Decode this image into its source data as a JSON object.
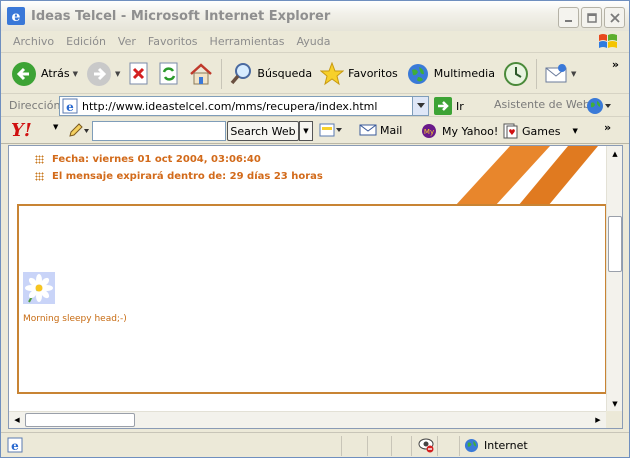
{
  "window": {
    "title": "Ideas Telcel - Microsoft Internet Explorer"
  },
  "menu": [
    "Archivo",
    "Edición",
    "Ver",
    "Favoritos",
    "Herramientas",
    "Ayuda"
  ],
  "toolbar": {
    "back_label": "Atrás",
    "search_label": "Búsqueda",
    "favorites_label": "Favoritos",
    "media_label": "Multimedia"
  },
  "address": {
    "label": "Dirección",
    "url": "http://www.ideastelcel.com/mms/recupera/index.html",
    "go_label": "Ir",
    "assistant_label": "Asistente de Web"
  },
  "yahoo": {
    "logo": "Y!",
    "search_button": "Search Web",
    "search_value": "",
    "mail_label": "Mail",
    "myyahoo_label": "My Yahoo!",
    "games_label": "Games"
  },
  "page": {
    "date_line": "Fecha: viernes 01 oct 2004, 03:06:40",
    "expiry_line": "El mensaje expirará dentro de: 29 días 23 horas",
    "message_text": "Morning sleepy head;-)"
  },
  "status": {
    "zone_label": "Internet"
  },
  "colors": {
    "accent_orange": "#d26a1a",
    "stripe_orange": "#e8862c",
    "box_border": "#c88434"
  },
  "icons": {
    "ie": "ie-icon",
    "back": "back-arrow-icon",
    "forward": "forward-arrow-icon",
    "stop": "stop-icon",
    "refresh": "refresh-icon",
    "home": "home-icon",
    "search": "magnifier-icon",
    "favorites": "star-icon",
    "media": "globe-icon",
    "history": "history-icon",
    "mail": "envelope-icon"
  }
}
